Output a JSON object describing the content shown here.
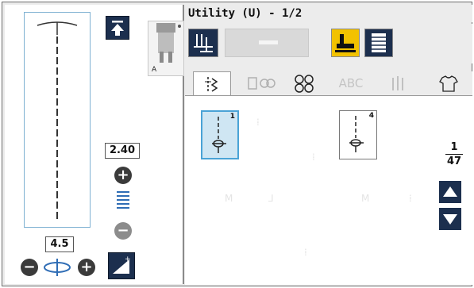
{
  "left_panel": {
    "stitch_length_value": "2.40",
    "stitch_width_value": "4.5",
    "presser_foot_label": "A",
    "increase_symbol": "+",
    "decrease_symbol": "−"
  },
  "header": {
    "title": "Utility (U) - 1/2"
  },
  "tabs": [
    {
      "name": "utility-stitches",
      "glyph": "⸽",
      "active": true
    },
    {
      "name": "decorative-stitches",
      "glyph": "⊞",
      "active": false
    },
    {
      "name": "quilt-stitches",
      "glyph": "✂",
      "active": false
    },
    {
      "name": "alphabet",
      "glyph": "ABC",
      "active": false
    },
    {
      "name": "buttonhole",
      "glyph": "⇱",
      "active": false
    },
    {
      "name": "garment",
      "glyph": "👕",
      "active": false
    }
  ],
  "stitches": [
    {
      "number": "1",
      "selected": true
    },
    {
      "number": "4",
      "selected": false
    }
  ],
  "pagination": {
    "current": "1",
    "total": "47"
  },
  "colors": {
    "dark_button": "#1c2f4e",
    "accent_yellow": "#f2c200",
    "selection_blue": "#4aa3d6"
  }
}
